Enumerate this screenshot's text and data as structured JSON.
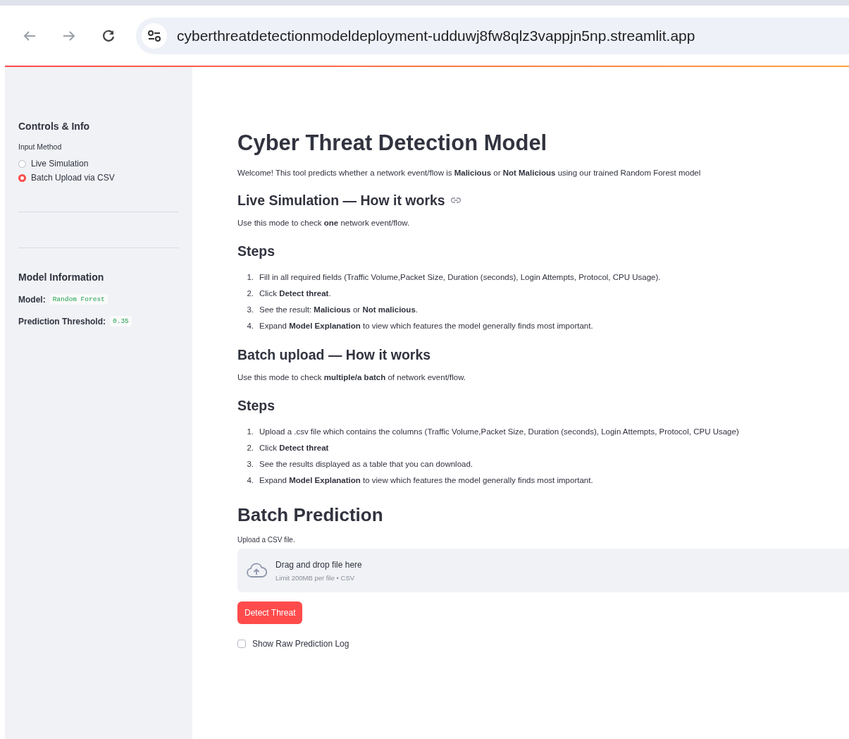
{
  "browser": {
    "url": "cyberthreatdetectionmodeldeployment-udduwj8fw8qlz3vappjn5np.streamlit.app"
  },
  "sidebar": {
    "title": "Controls & Info",
    "input_method": {
      "label": "Input Method",
      "options": [
        {
          "label": "Live Simulation",
          "selected": false
        },
        {
          "label": "Batch Upload via CSV",
          "selected": true
        }
      ]
    },
    "model_info": {
      "title": "Model Information",
      "items": [
        {
          "label": "Model:",
          "value": "Random Forest"
        },
        {
          "label": "Prediction Threshold:",
          "value": "0.35"
        }
      ]
    }
  },
  "main": {
    "title": "Cyber Threat Detection Model",
    "intro": "Welcome! This tool predicts whether a network event/flow is **Malicious** or **Not Malicious** using our trained Random Forest model",
    "sections": [
      {
        "heading": "Live Simulation — How it works",
        "anchor_icon": true,
        "description": "Use this mode to check **one** network event/flow.",
        "steps_heading": "Steps",
        "steps": [
          {
            "number": "1.",
            "text": "Fill in all required fields (Traffic Volume,Packet Size, Duration (seconds), Login Attempts, Protocol, CPU Usage)."
          },
          {
            "number": "2.",
            "text": "Click **Detect threat**."
          },
          {
            "number": "3.",
            "text": "See the result: **Malicious** or **Not malicious**."
          },
          {
            "number": "4.",
            "text": "Expand **Model Explanation** to view which features the model generally finds most important."
          }
        ]
      },
      {
        "heading": "Batch upload — How it works",
        "anchor_icon": false,
        "description": "Use this mode to check **multiple/a batch** of network event/flow.",
        "steps_heading": "Steps",
        "steps": [
          {
            "number": "1.",
            "text": "Upload a .csv file which contains the columns (Traffic Volume,Packet Size, Duration (seconds), Login Attempts, Protocol, CPU Usage)"
          },
          {
            "number": "2.",
            "text": "Click **Detect threat**"
          },
          {
            "number": "3.",
            "text": "See the results displayed as a table that you can download."
          },
          {
            "number": "4.",
            "text": "Expand **Model Explanation** to view which features the model generally finds most important."
          }
        ]
      }
    ]
  },
  "batch": {
    "title": "Batch Prediction",
    "upload_label": "Upload a CSV file.",
    "dropzone": {
      "text": "Drag and drop file here",
      "limit": "Limit 200MB per file • CSV"
    },
    "button": "Detect Threat",
    "checkbox": {
      "label": "Show Raw Prediction Log",
      "checked": false
    }
  }
}
